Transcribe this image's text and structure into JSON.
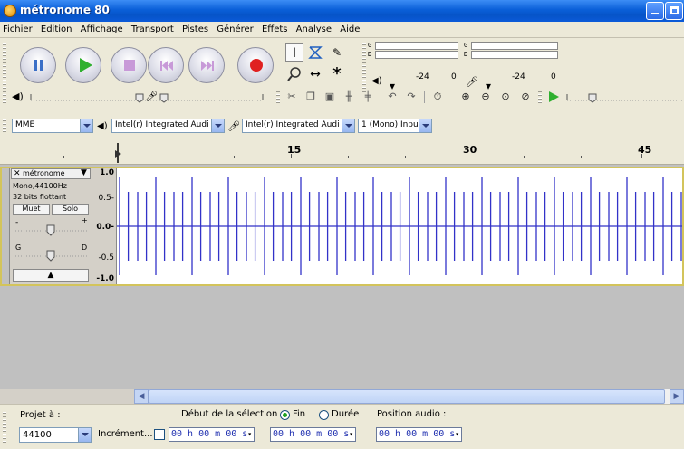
{
  "window": {
    "title": "métronome 80"
  },
  "menu": [
    "Fichier",
    "Edition",
    "Affichage",
    "Transport",
    "Pistes",
    "Générer",
    "Effets",
    "Analyse",
    "Aide"
  ],
  "meters": {
    "play_channels": [
      "G",
      "D"
    ],
    "record_channels": [
      "G",
      "D"
    ],
    "scale_db": [
      "-24",
      "0",
      "-24",
      "0"
    ]
  },
  "devices": {
    "host": "MME",
    "playback": "Intel(r) Integrated Audi",
    "recording": "Intel(r) Integrated Audi",
    "channels": "1 (Mono) Inpu"
  },
  "timeline": {
    "labels": [
      "15",
      "30",
      "45"
    ]
  },
  "track": {
    "name": "métronome",
    "info_line1": "Mono,44100Hz",
    "info_line2": "32 bits flottant",
    "mute_label": "Muet",
    "solo_label": "Solo",
    "gain_min": "-",
    "gain_max": "+",
    "pan_left": "G",
    "pan_right": "D",
    "scale": [
      "1.0",
      "0.5-",
      "0.0-",
      "-0.5",
      "-1.0"
    ]
  },
  "selection_bar": {
    "project_rate_label": "Projet à :",
    "project_rate_value": "44100",
    "increment_label": "Incrément...",
    "selection_start_label": "Début de la sélection",
    "end_label": "Fin",
    "duration_label": "Durée",
    "audio_position_label": "Position audio :",
    "start_time": "00 h 00 m 00 s",
    "end_time": "00 h 00 m 00 s",
    "audio_time": "00 h 00 m 00 s",
    "end_selected": true
  },
  "colors": {
    "waveform": "#3232c8",
    "title_bar": "#0a5fd8"
  }
}
